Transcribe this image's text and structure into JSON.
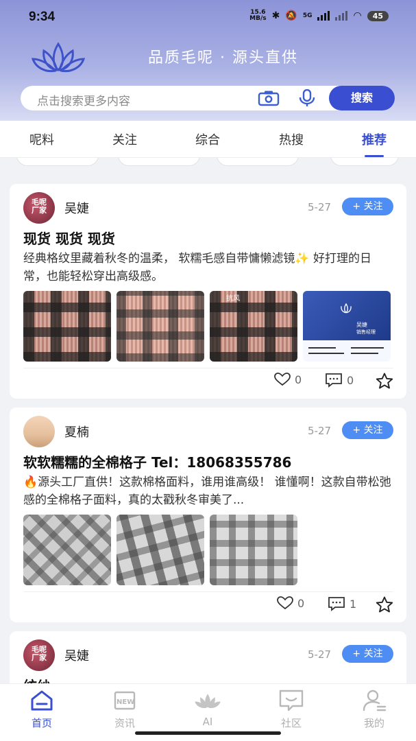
{
  "status_bar": {
    "time": "9:34",
    "speed_value": "15.6",
    "speed_unit": "MB/s",
    "network": "5G",
    "battery": "45"
  },
  "header": {
    "slogan": "品质毛呢 · 源头直供",
    "logo_icon": "lotus-logo-icon"
  },
  "search": {
    "placeholder": "点击搜索更多内容",
    "button_label": "搜索"
  },
  "tabs": [
    {
      "label": "呢料"
    },
    {
      "label": "关注"
    },
    {
      "label": "综合"
    },
    {
      "label": "热搜"
    },
    {
      "label": "推荐",
      "active": true
    }
  ],
  "posts": [
    {
      "user": "吴婕",
      "avatar_text": [
        "毛呢",
        "厂家"
      ],
      "date": "5-27",
      "follow_label": "+ 关注",
      "title": "现货 现货 现货",
      "body": "经典格纹里藏着秋冬的温柔， 软糯毛感自带慵懒滤镜✨ 好打理的日常，也能轻松穿出高级感。",
      "image_overlay_text": "抗风",
      "card_contact_name": "吴婕",
      "card_contact_title": "销售经理",
      "likes": "0",
      "comments": "0"
    },
    {
      "user": "夏楠",
      "date": "5-27",
      "follow_label": "+ 关注",
      "title": "软软糯糯的全棉格子 Tel：18068355786",
      "body": "🔥源头工厂直供！这款棉格面料，谁用谁高级！ 谁懂啊！这款自带松弛感的全棉格子面料，真的太戳秋冬审美了...",
      "likes": "0",
      "comments": "1"
    },
    {
      "user": "吴婕",
      "avatar_text": [
        "毛呢",
        "厂家"
      ],
      "date": "5-27",
      "follow_label": "+ 关注",
      "title": "纺纱"
    }
  ],
  "bottom_nav": [
    {
      "label": "首页",
      "icon": "home-icon",
      "active": true
    },
    {
      "label": "资讯",
      "icon": "news-icon"
    },
    {
      "label": "AI",
      "icon": "ai-lotus-icon"
    },
    {
      "label": "社区",
      "icon": "community-chat-icon"
    },
    {
      "label": "我的",
      "icon": "profile-icon"
    }
  ],
  "colors": {
    "accent": "#3a4ed1",
    "follow": "#4e8df3",
    "header_gradient_top": "#8c94d8"
  }
}
